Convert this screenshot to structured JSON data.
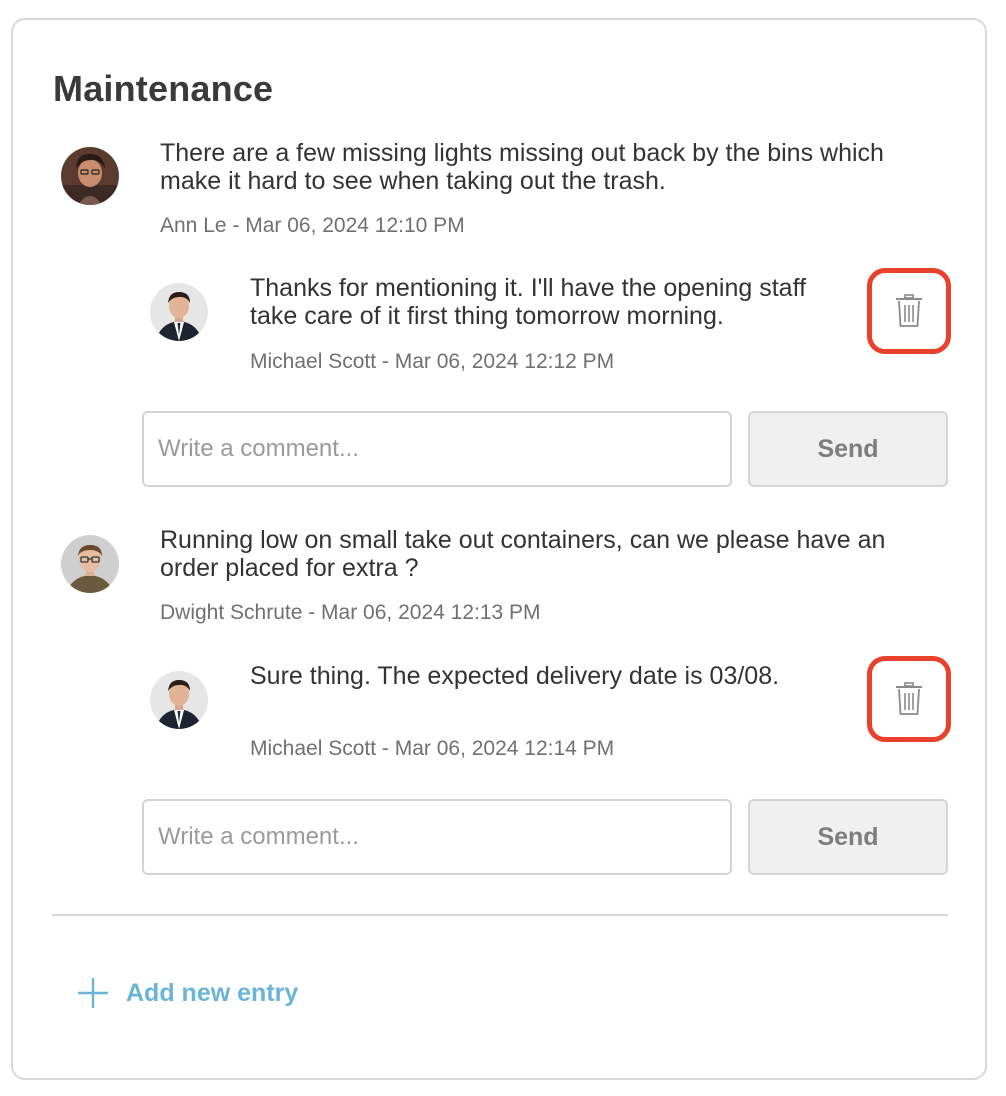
{
  "section": {
    "title": "Maintenance"
  },
  "threads": [
    {
      "post": {
        "text": "There are a few missing lights missing out back by the bins which make it hard to see when taking out the trash.",
        "meta": "Ann Le - Mar 06, 2024 12:10 PM"
      },
      "reply": {
        "text": "Thanks for mentioning it. I'll have the opening staff take care of it first thing tomorrow morning.",
        "meta": "Michael Scott - Mar 06, 2024 12:12 PM"
      },
      "comment_placeholder": "Write a comment...",
      "send_label": "Send"
    },
    {
      "post": {
        "text": "Running low on small take out containers, can we please have an order placed for extra ?",
        "meta": "Dwight Schrute - Mar 06, 2024 12:13 PM"
      },
      "reply": {
        "text": "Sure thing. The expected delivery date is 03/08.",
        "meta": "Michael Scott - Mar 06, 2024 12:14 PM"
      },
      "comment_placeholder": "Write a comment...",
      "send_label": "Send"
    }
  ],
  "add_entry": {
    "label": "Add new entry",
    "icon": "plus-icon"
  },
  "icons": {
    "delete": "trash-icon"
  },
  "colors": {
    "highlight": "#e8412c",
    "link": "#6ab4d8",
    "border": "#d9d9d9",
    "text": "#333333",
    "meta": "#707070"
  }
}
